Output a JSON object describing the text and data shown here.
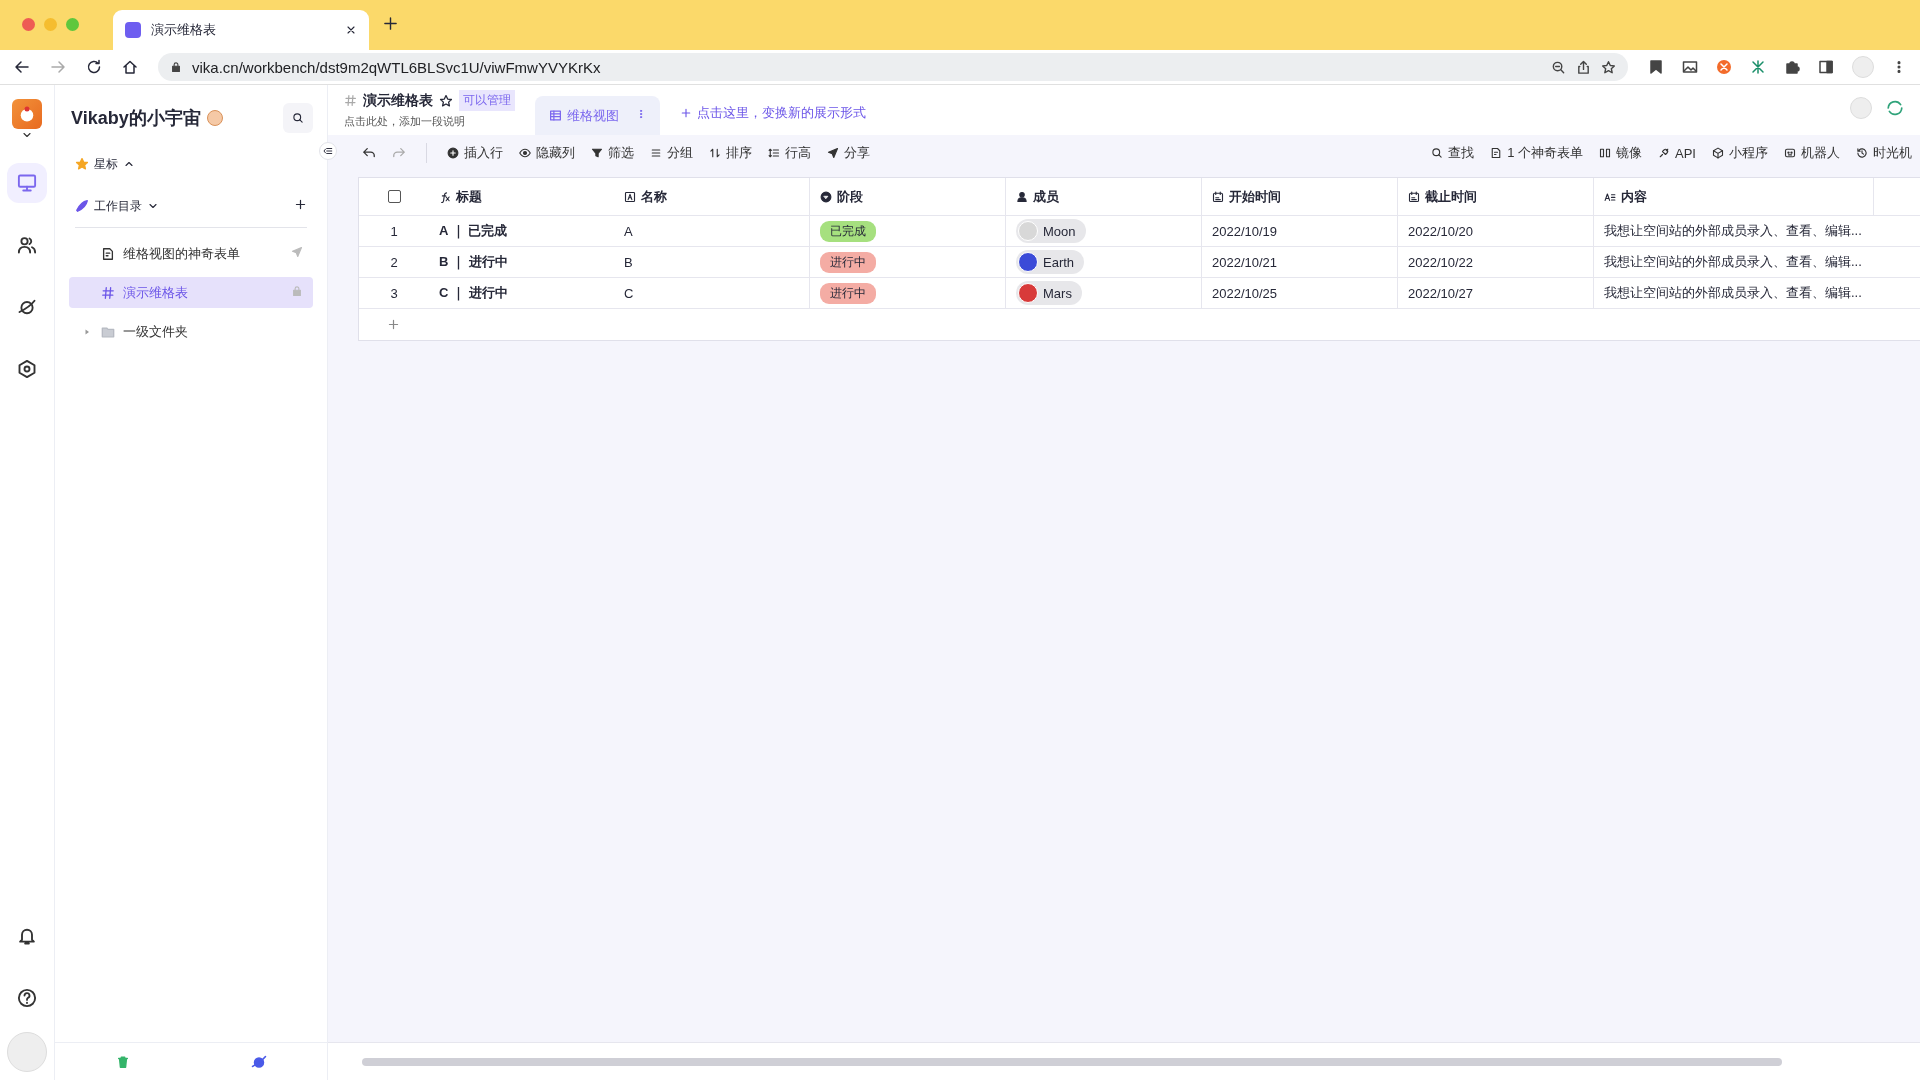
{
  "browser": {
    "tab_title": "演示维格表",
    "url": "vika.cn/workbench/dst9m2qWTL6BLSvc1U/viwFmwYVYKrKx"
  },
  "sidebar": {
    "space_name": "Vikaby的小宇宙",
    "starred": "星标",
    "workspace": "工作目录",
    "items": [
      {
        "kind": "form",
        "label": "维格视图的神奇表单",
        "selected": false
      },
      {
        "kind": "sheet",
        "label": "演示维格表",
        "selected": true
      },
      {
        "kind": "folder",
        "label": "一级文件夹",
        "selected": false,
        "expanded": false
      }
    ]
  },
  "datasheet": {
    "title": "演示维格表",
    "permission": "可以管理",
    "description": "点击此处，添加一段说明",
    "views": [
      {
        "label": "维格视图",
        "selected": true
      }
    ],
    "add_view": "点击这里，变换新的展示形式"
  },
  "toolbar": {
    "left": [
      {
        "kind": "insert",
        "label": "插入行"
      },
      {
        "kind": "hide",
        "label": "隐藏列"
      },
      {
        "kind": "filter",
        "label": "筛选"
      },
      {
        "kind": "group",
        "label": "分组"
      },
      {
        "kind": "sort",
        "label": "排序"
      },
      {
        "kind": "height",
        "label": "行高"
      },
      {
        "kind": "share",
        "label": "分享"
      }
    ],
    "right": [
      {
        "kind": "search",
        "label": "查找"
      },
      {
        "kind": "form",
        "label": "1 个神奇表单"
      },
      {
        "kind": "mirror",
        "label": "镜像"
      },
      {
        "kind": "api",
        "label": "API"
      },
      {
        "kind": "widget",
        "label": "小程序"
      },
      {
        "kind": "robot",
        "label": "机器人"
      },
      {
        "kind": "history",
        "label": "时光机"
      }
    ]
  },
  "table": {
    "all_selected": false,
    "columns": [
      {
        "kind": "formula",
        "label": "标题"
      },
      {
        "kind": "text",
        "label": "名称"
      },
      {
        "kind": "select",
        "label": "阶段"
      },
      {
        "kind": "member",
        "label": "成员"
      },
      {
        "kind": "date",
        "label": "开始时间"
      },
      {
        "kind": "date",
        "label": "截止时间"
      },
      {
        "kind": "longtext",
        "label": "内容"
      }
    ],
    "rows": [
      {
        "number": "1",
        "title": "A ｜ 已完成",
        "name": "A",
        "stage": {
          "label": "已完成",
          "color": "#a6e07f"
        },
        "member": {
          "name": "Moon",
          "color": "#d8d8d8"
        },
        "start": "2022/10/19",
        "end": "2022/10/20",
        "content": "我想让空间站的外部成员录入、查看、编辑..."
      },
      {
        "number": "2",
        "title": "B ｜ 进行中",
        "name": "B",
        "stage": {
          "label": "进行中",
          "color": "#f4aca4"
        },
        "member": {
          "name": "Earth",
          "color": "#3b4bd8"
        },
        "start": "2022/10/21",
        "end": "2022/10/22",
        "content": "我想让空间站的外部成员录入、查看、编辑..."
      },
      {
        "number": "3",
        "title": "C ｜ 进行中",
        "name": "C",
        "stage": {
          "label": "进行中",
          "color": "#f4aca4"
        },
        "member": {
          "name": "Mars",
          "color": "#d83a3a"
        },
        "start": "2022/10/25",
        "end": "2022/10/27",
        "content": "我想让空间站的外部成员录入、查看、编辑..."
      }
    ]
  }
}
